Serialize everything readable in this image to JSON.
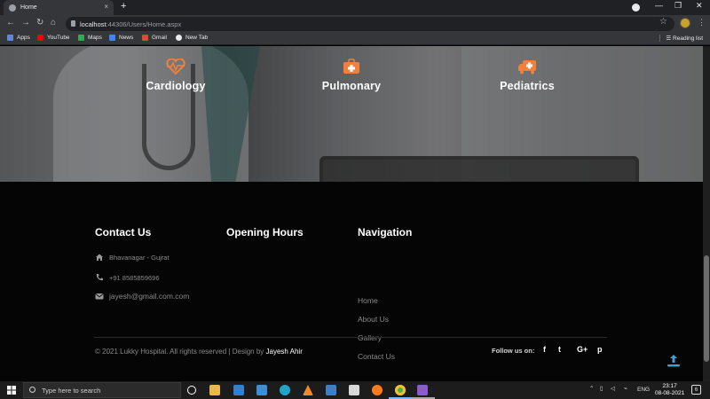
{
  "browser": {
    "tab_title": "Home",
    "tab_close": "×",
    "new_tab": "+",
    "url_host": "localhost",
    "url_path": ":44306/Users/Home.aspx",
    "window_controls": {
      "minimize": "—",
      "restore": "❐",
      "close": "✕"
    },
    "nav": {
      "back": "←",
      "forward": "→",
      "reload": "↻",
      "home": "⌂"
    },
    "star": "☆",
    "menu": "⋮"
  },
  "bookmarks": {
    "items": [
      {
        "label": "Apps",
        "icon": "apps-grid-icon",
        "color": "#5f87d6"
      },
      {
        "label": "YouTube",
        "icon": "youtube-icon",
        "color": "#ff0000"
      },
      {
        "label": "Maps",
        "icon": "maps-icon",
        "color": "#34a853"
      },
      {
        "label": "News",
        "icon": "news-icon",
        "color": "#4285f4"
      },
      {
        "label": "Gmail",
        "icon": "gmail-icon",
        "color": "#ea4335"
      },
      {
        "label": "New Tab",
        "icon": "globe-icon",
        "color": "#e8eaed"
      }
    ],
    "reading_list": "Reading list"
  },
  "services": [
    {
      "label": "Cardiology",
      "icon": "heartbeat-icon"
    },
    {
      "label": "Pulmonary",
      "icon": "medical-kit-icon"
    },
    {
      "label": "Pediatrics",
      "icon": "ambulance-icon"
    }
  ],
  "accent_color": "#f0803c",
  "footer": {
    "contact": {
      "title": "Contact Us",
      "address": "Bhavanagar - Gujrat",
      "phone": "+91 8585859696",
      "email": "jayesh@gmail.com.com"
    },
    "hours": {
      "title": "Opening Hours"
    },
    "navigation": {
      "title": "Navigation",
      "links": [
        "Home",
        "About Us",
        "Gallery",
        "Contact Us"
      ]
    },
    "copyright_prefix": "© 2021 Lukky Hospital. All rights reserved | Design by ",
    "copyright_author": "Jayesh Ahir",
    "follow_label": "Follow us on:",
    "social": [
      {
        "label": "f",
        "icon": "facebook-icon"
      },
      {
        "label": "t",
        "icon": "twitter-icon"
      },
      {
        "label": "G+",
        "icon": "google-plus-icon"
      },
      {
        "label": "p",
        "icon": "pinterest-icon"
      }
    ]
  },
  "taskbar": {
    "search_placeholder": "Type here to search",
    "lang": "ENG",
    "time": "23:17",
    "date": "08-08-2021",
    "notifications": "6"
  }
}
